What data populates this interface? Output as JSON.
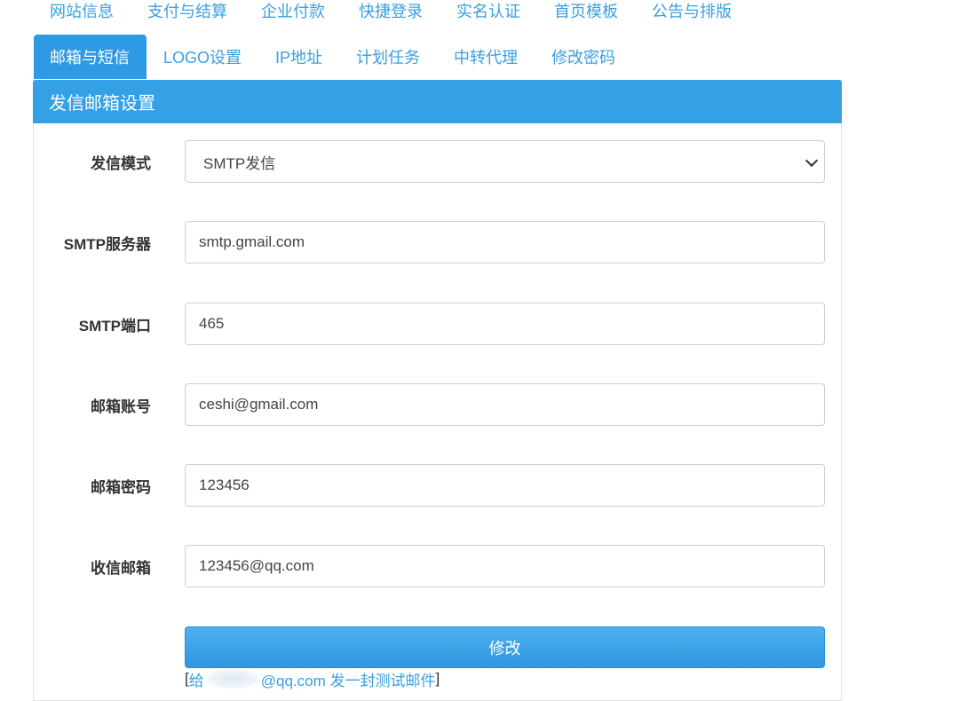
{
  "nav": {
    "row1": [
      "网站信息",
      "支付与结算",
      "企业付款",
      "快捷登录",
      "实名认证",
      "首页模板",
      "公告与排版"
    ],
    "row2": [
      "邮箱与短信",
      "LOGO设置",
      "IP地址",
      "计划任务",
      "中转代理",
      "修改密码"
    ],
    "active": "邮箱与短信"
  },
  "panel": {
    "title": "发信邮箱设置"
  },
  "form": {
    "mode_label": "发信模式",
    "mode_value": "SMTP发信",
    "server_label": "SMTP服务器",
    "server_value": "smtp.gmail.com",
    "port_label": "SMTP端口",
    "port_value": "465",
    "account_label": "邮箱账号",
    "account_value": "ceshi@gmail.com",
    "password_label": "邮箱密码",
    "password_value": "123456",
    "receiver_label": "收信邮箱",
    "receiver_value": "123456@qq.com",
    "submit_label": "修改"
  },
  "test_mail": {
    "open_bracket": "[",
    "prefix": "给",
    "suffix": "@qq.com 发一封测试邮件",
    "close_bracket": "]"
  },
  "colors": {
    "accent": "#34a0e6",
    "link": "#3a9fe0"
  }
}
